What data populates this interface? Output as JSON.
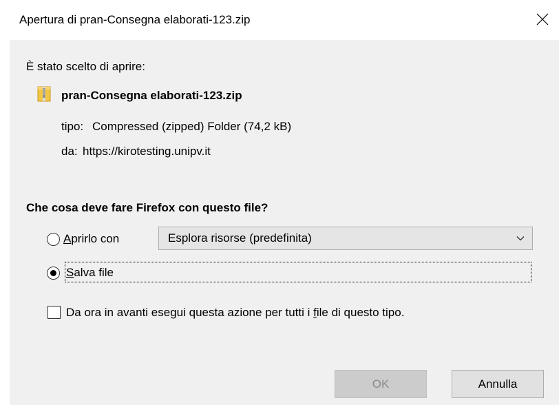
{
  "window": {
    "title": "Apertura di pran-Consegna elaborati-123.zip",
    "close_icon": "close-icon"
  },
  "dialog": {
    "intro": "È stato scelto di aprire:",
    "file_icon": "zip-folder-icon",
    "file_name": "pran-Consegna elaborati-123.zip",
    "type_label": "tipo:",
    "type_value": "Compressed (zipped) Folder (74,2 kB)",
    "from_label": "da:",
    "from_value": "https://kirotesting.unipv.it",
    "question": "Che cosa deve fare Firefox con questo file?"
  },
  "options": {
    "open_with": {
      "mnemonic": "A",
      "rest": "prirlo con",
      "selected": false,
      "app_value": "Esplora risorse (predefinita)"
    },
    "save_file": {
      "mnemonic": "S",
      "rest": "alva file",
      "selected": true
    },
    "remember": {
      "text_before": "Da ora in avanti esegui questa azione per tutti i ",
      "mnemonic": "f",
      "text_after": "ile di questo tipo.",
      "checked": false
    }
  },
  "buttons": {
    "ok": "OK",
    "cancel": "Annulla"
  },
  "colors": {
    "client_background": "#f0f0f0",
    "titlebar_background": "#ffffff",
    "disabled_text": "#8a8a8a"
  }
}
